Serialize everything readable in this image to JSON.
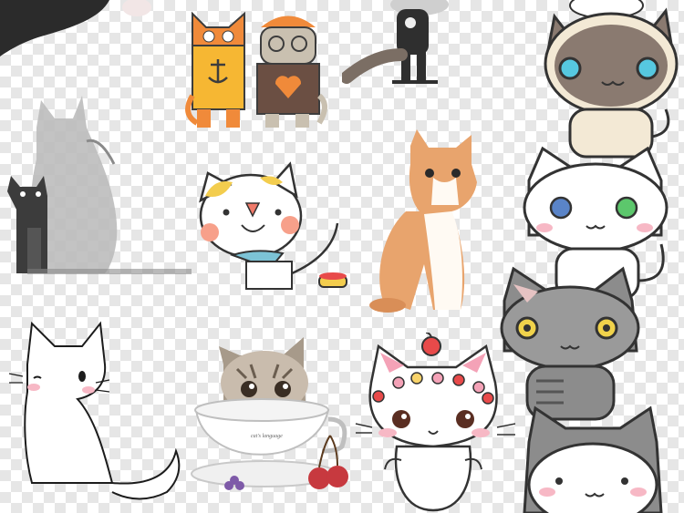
{
  "canvas": {
    "background": "transparency-checkerboard",
    "checker_light": "#ffffff",
    "checker_dark": "#e6e6e6"
  },
  "artworks": [
    {
      "name": "black-figure-corner",
      "colors": [
        "#2b2b2b",
        "#f2c9c9"
      ]
    },
    {
      "name": "orange-striped-cat-with-anchor-sweater",
      "colors": [
        "#f08a3a",
        "#f6b733",
        "#3d3d3d"
      ]
    },
    {
      "name": "glasses-cat-heart-sweater",
      "colors": [
        "#c9c0b0",
        "#6b4f43",
        "#f08a3a"
      ]
    },
    {
      "name": "dark-cat-walking-cartoon",
      "colors": [
        "#2f2f2f",
        "#7b6e64"
      ]
    },
    {
      "name": "siamese-chibi-cat",
      "colors": [
        "#f3e9d5",
        "#8a7a70",
        "#56c8e0"
      ]
    },
    {
      "name": "sketch-gray-cat-silhouette",
      "colors": [
        "#b9b9b9",
        "#3c3c3c"
      ]
    },
    {
      "name": "white-cat-blue-scarf",
      "colors": [
        "#ffffff",
        "#f3cd4e",
        "#f07a6a",
        "#7cc3d6"
      ]
    },
    {
      "name": "orange-white-kitten-photo",
      "colors": [
        "#e8a46d",
        "#fffaf3"
      ]
    },
    {
      "name": "white-chibi-cat-heterochromia",
      "colors": [
        "#ffffff",
        "#5a84c8",
        "#5cc76c"
      ]
    },
    {
      "name": "white-cat-line-art",
      "colors": [
        "#ffffff",
        "#1c1c1c",
        "#f7b8c5"
      ]
    },
    {
      "name": "tabby-kitten-in-teacup",
      "colors": [
        "#a79a8a",
        "#ffffff",
        "#c7393f"
      ]
    },
    {
      "name": "white-cat-with-cherry-and-candies",
      "colors": [
        "#ffffff",
        "#e84a4a",
        "#f4a2b7"
      ]
    },
    {
      "name": "gray-chibi-cat",
      "colors": [
        "#8c8c8c",
        "#f0d24b"
      ]
    },
    {
      "name": "gray-white-chibi-cat-bottom",
      "colors": [
        "#8c8c8c",
        "#ffffff"
      ]
    }
  ],
  "teacup": {
    "text": "cat's language"
  }
}
